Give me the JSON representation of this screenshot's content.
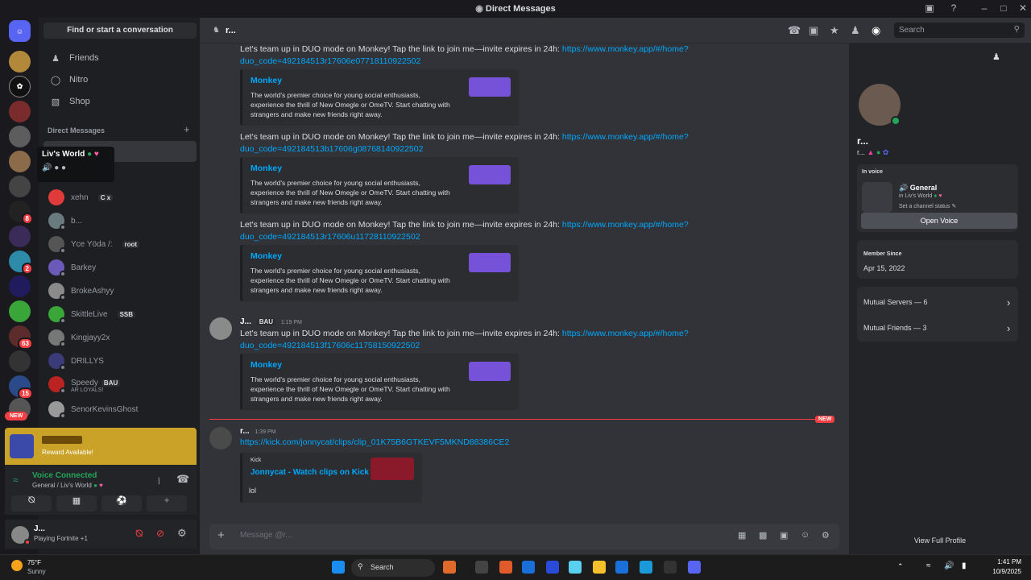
{
  "window": {
    "title": "Direct Messages"
  },
  "find_conversation": "Find or start a conversation",
  "nav": {
    "friends": "Friends",
    "nitro": "Nitro",
    "shop": "Shop"
  },
  "direct_messages_label": "Direct Messages",
  "tooltip": {
    "title": "Liv's World"
  },
  "dms": [
    {
      "name": "xehn",
      "tag": "C x",
      "sub": ""
    },
    {
      "name": "b...",
      "tag": "",
      "sub": ""
    },
    {
      "name": "Yce Yöda /:",
      "tag": "root",
      "sub": ""
    },
    {
      "name": "Barkey",
      "tag": "",
      "sub": ""
    },
    {
      "name": "BrokeAshyy",
      "tag": "",
      "sub": ""
    },
    {
      "name": "SkittleLive",
      "tag": "SSB",
      "sub": ""
    },
    {
      "name": "Kingjayy2x",
      "tag": "",
      "sub": ""
    },
    {
      "name": "DRILLYS",
      "tag": "",
      "sub": ""
    },
    {
      "name": "Speedy",
      "tag": "BAU",
      "sub": "AR LOYALS!"
    },
    {
      "name": "SenorKevinsGhost",
      "tag": "",
      "sub": ""
    }
  ],
  "guild_badges": [
    "8",
    "2",
    "63",
    "15"
  ],
  "new_badge": "NEW",
  "quest": {
    "title": "Reward Available!"
  },
  "voice": {
    "status": "Voice Connected",
    "channel": "General / Liv's World"
  },
  "user": {
    "name": "J...",
    "activity": "Playing Fortnite +1"
  },
  "chat": {
    "recipient": "r...",
    "search_placeholder": "Search",
    "messages": [
      {
        "text": "Let's team up in DUO mode on Monkey! Tap the link to join me—invite expires in 24h: ",
        "link": "https://www.monkey.app/#/home?duo_code=492184513r17606e07718110922502"
      },
      {
        "text": "Let's team up in DUO mode on Monkey! Tap the link to join me—invite expires in 24h: ",
        "link": "https://www.monkey.app/#/home?duo_code=492184513b17606g08768140922502"
      },
      {
        "text": "Let's team up in DUO mode on Monkey! Tap the link to join me—invite expires in 24h: ",
        "link": "https://www.monkey.app/#/home?duo_code=492184513r17606u11728110922502"
      },
      {
        "author": "J...",
        "author_tag": "BAU",
        "time": "1:19 PM",
        "text": "Let's team up in DUO mode on Monkey! Tap the link to join me—invite expires in 24h: ",
        "link": "https://www.monkey.app/#/home?duo_code=492184513f17606c11758150922502"
      }
    ],
    "embed": {
      "title": "Monkey",
      "description": "The world's premier choice for young social enthusiasts, experience the thrill of New Omegle or OmeTV. Start chatting with strangers and make new friends right away."
    },
    "new_divider": "NEW",
    "last": {
      "author": "r...",
      "time": "1:39 PM",
      "link": "https://kick.com/jonnycat/clips/clip_01K75B6GTKEVF5MKND88386CE2",
      "embed_provider": "Kick",
      "embed_title": "Jonnycat - Watch clips on Kick",
      "reply": "lol"
    },
    "composer_placeholder": "Message @r..."
  },
  "profile": {
    "name": "r...",
    "handle": "r...",
    "in_voice_label": "In voice",
    "voice_channel": "General",
    "voice_server": "in Liv's World",
    "channel_status": "Set a channel status",
    "open_voice": "Open Voice",
    "member_since_label": "Member Since",
    "member_since": "Apr 15, 2022",
    "mutual_servers": "Mutual Servers — 6",
    "mutual_friends": "Mutual Friends — 3",
    "view_full": "View Full Profile"
  },
  "taskbar": {
    "weather_temp": "75°F",
    "weather_desc": "Sunny",
    "search": "Search",
    "time": "1:41 PM",
    "date": "10/9/2025"
  }
}
